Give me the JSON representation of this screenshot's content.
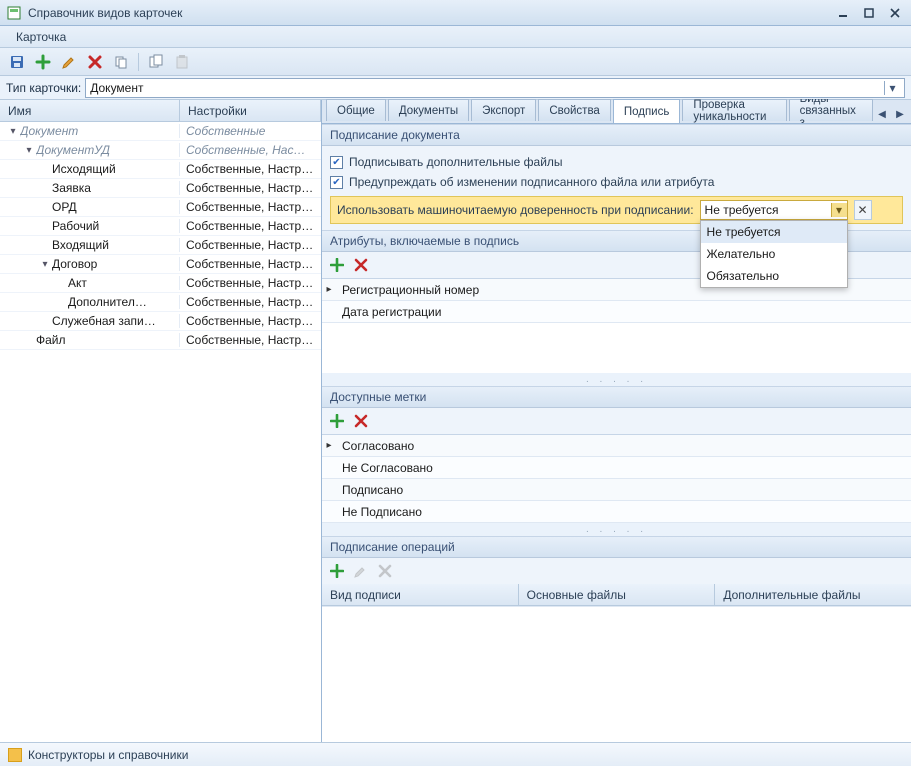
{
  "window": {
    "title": "Справочник видов карточек"
  },
  "menubar": {
    "items": [
      "Карточка"
    ]
  },
  "toolbar_icons": [
    "save",
    "add",
    "edit",
    "delete",
    "copy",
    "sep",
    "duplicate",
    "paste"
  ],
  "typebar": {
    "label": "Тип карточки:",
    "value": "Документ"
  },
  "tree": {
    "columns": [
      "Имя",
      "Настройки"
    ],
    "rows": [
      {
        "depth": 0,
        "exp": "v",
        "name": "Документ",
        "settings": "Собственные",
        "italic": true
      },
      {
        "depth": 1,
        "exp": "v",
        "name": "ДокументУД",
        "settings": "Собственные, Наст…",
        "italic": true
      },
      {
        "depth": 2,
        "exp": "",
        "name": "Исходящий",
        "settings": "Собственные, Настро…"
      },
      {
        "depth": 2,
        "exp": "",
        "name": "Заявка",
        "settings": "Собственные, Настро…"
      },
      {
        "depth": 2,
        "exp": "",
        "name": "ОРД",
        "settings": "Собственные, Настро…"
      },
      {
        "depth": 2,
        "exp": "",
        "name": "Рабочий",
        "settings": "Собственные, Настро…"
      },
      {
        "depth": 2,
        "exp": "",
        "name": "Входящий",
        "settings": "Собственные, Настро…"
      },
      {
        "depth": 2,
        "exp": "v",
        "name": "Договор",
        "settings": "Собственные, Настро…"
      },
      {
        "depth": 3,
        "exp": "",
        "name": "Акт",
        "settings": "Собственные, Настро…"
      },
      {
        "depth": 3,
        "exp": "",
        "name": "Дополнител…",
        "settings": "Собственные, Настро…"
      },
      {
        "depth": 2,
        "exp": "",
        "name": "Служебная запи…",
        "settings": "Собственные, Настро…"
      },
      {
        "depth": 1,
        "exp": "",
        "name": "Файл",
        "settings": "Собственные, Настро…"
      }
    ]
  },
  "tabs": {
    "items": [
      "Общие",
      "Документы",
      "Экспорт",
      "Свойства",
      "Подпись",
      "Проверка уникальности",
      "Виды связанных з"
    ],
    "active": 4
  },
  "signing": {
    "section_title": "Подписание документа",
    "chk_additional": {
      "checked": true,
      "label": "Подписывать дополнительные файлы"
    },
    "chk_warn": {
      "checked": true,
      "label": "Предупреждать об изменении подписанного файла или атрибута"
    },
    "poa": {
      "label": "Использовать машиночитаемую доверенность при подписании:",
      "value": "Не требуется",
      "options": [
        "Не требуется",
        "Желательно",
        "Обязательно"
      ]
    }
  },
  "attrs": {
    "title": "Атрибуты, включаемые в подпись",
    "rows": [
      "Регистрационный номер",
      "Дата регистрации"
    ]
  },
  "marks": {
    "title": "Доступные метки",
    "rows": [
      "Согласовано",
      "Не Согласовано",
      "Подписано",
      "Не Подписано"
    ]
  },
  "ops": {
    "title": "Подписание операций",
    "columns": [
      "Вид подписи",
      "Основные файлы",
      "Дополнительные файлы"
    ]
  },
  "status": {
    "text": "Конструкторы и справочники"
  }
}
